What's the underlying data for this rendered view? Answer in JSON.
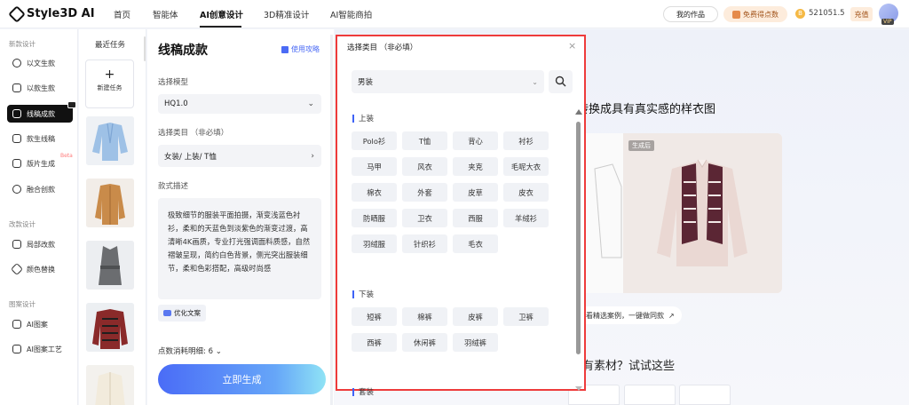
{
  "app": {
    "brand": "Style3D AI"
  },
  "nav": {
    "tabs": [
      "首页",
      "智能体",
      "AI创意设计",
      "3D精准设计",
      "AI智能商拍"
    ],
    "active_tab": "AI创意设计",
    "my_works": "我的作品",
    "free_points": "免费得点数",
    "points": "521051.5",
    "recharge": "充值",
    "vip": "VIP"
  },
  "sidebar": {
    "sections": [
      {
        "title": "新款设计",
        "items": [
          {
            "label": "以文生款",
            "icon": "text-to-style-icon"
          },
          {
            "label": "以款生款",
            "icon": "style-to-style-icon"
          },
          {
            "label": "线稿成款",
            "icon": "sketch-to-style-icon",
            "active": true
          },
          {
            "label": "款生线稿",
            "icon": "style-to-sketch-icon"
          },
          {
            "label": "版片生成",
            "icon": "pattern-generate-icon",
            "badge": "Beta"
          },
          {
            "label": "融合创款",
            "icon": "fusion-icon"
          }
        ]
      },
      {
        "title": "改款设计",
        "items": [
          {
            "label": "局部改款",
            "icon": "partial-edit-icon"
          },
          {
            "label": "颜色替换",
            "icon": "color-replace-icon"
          }
        ]
      },
      {
        "title": "图案设计",
        "items": [
          {
            "label": "AI图案",
            "icon": "ai-pattern-icon"
          },
          {
            "label": "AI图案工艺",
            "icon": "ai-pattern-craft-icon"
          }
        ]
      }
    ]
  },
  "recent": {
    "title": "最近任务",
    "new_task": "新建任务",
    "plus": "+"
  },
  "form": {
    "title": "线稿成款",
    "guide": "使用攻略",
    "model_label": "选择模型",
    "model_value": "HQ1.0",
    "category_label": "选择类目 （非必填）",
    "category_value": "女装/ 上装/ T恤",
    "desc_label": "款式描述",
    "desc_text": "极致细节的服装平面拍摄，渐变浅蓝色衬衫，柔和的天蓝色到淡紫色的渐变过渡，高清晰4K画质，专业打光强调面料质感，自然褶皱呈现，简约白色背景，侧光突出服装细节，柔和色彩搭配，高级时尚感",
    "optimize": "优化文案",
    "cost": "点数消耗明细: 6",
    "generate": "立即生成"
  },
  "main": {
    "hero": "转换成具有真实感的样衣图",
    "after_tag": "生成后",
    "one_click": "看精选案例，一键做同款",
    "no_material": "有素材？试试这些"
  },
  "modal": {
    "title": "选择类目 （非必填）",
    "close": "×",
    "gender_value": "男装",
    "groups": [
      {
        "title": "上装",
        "items": [
          "Polo衫",
          "T恤",
          "背心",
          "衬衫",
          "马甲",
          "风衣",
          "夹克",
          "毛呢大衣",
          "棉衣",
          "外套",
          "皮草",
          "皮衣",
          "防晒服",
          "卫衣",
          "西服",
          "羊绒衫",
          "羽绒服",
          "针织衫",
          "毛衣"
        ]
      },
      {
        "title": "下装",
        "items": [
          "短裤",
          "棉裤",
          "皮裤",
          "卫裤",
          "西裤",
          "休闲裤",
          "羽绒裤"
        ]
      },
      {
        "title": "套装",
        "items": []
      }
    ]
  },
  "colors": {
    "accent": "#3f63f6",
    "highlight_border": "#ee3b3b",
    "active_nav": "#111111"
  }
}
